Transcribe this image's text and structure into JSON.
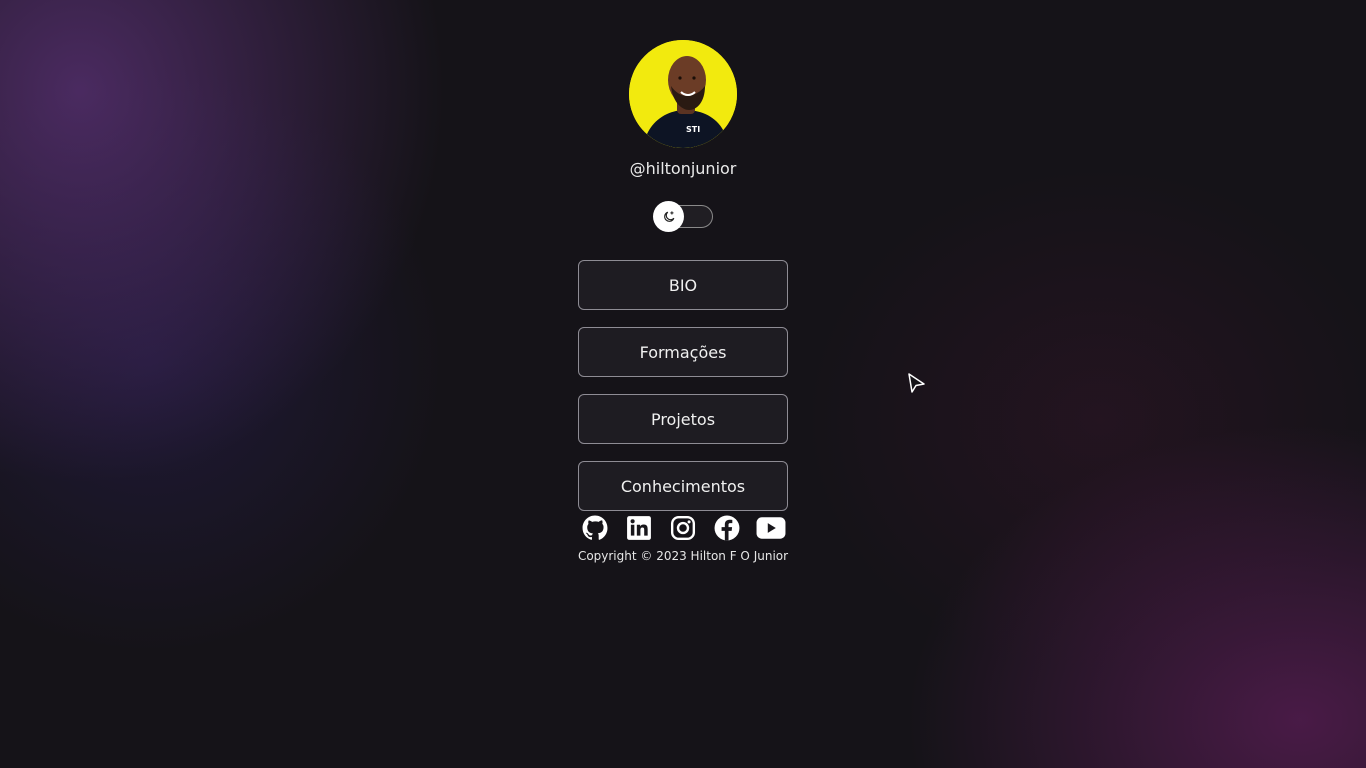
{
  "profile": {
    "handle": "@hiltonjunior",
    "avatar_icon": "profile-photo",
    "avatar_bg": "#f2ea0e"
  },
  "theme_toggle": {
    "icon": "moon-icon",
    "state": "dark"
  },
  "links": [
    {
      "label": "BIO"
    },
    {
      "label": "Formações"
    },
    {
      "label": "Projetos"
    },
    {
      "label": "Conhecimentos"
    }
  ],
  "socials": [
    {
      "icon": "github-icon"
    },
    {
      "icon": "linkedin-icon"
    },
    {
      "icon": "instagram-icon"
    },
    {
      "icon": "facebook-icon"
    },
    {
      "icon": "youtube-icon"
    }
  ],
  "footer": {
    "copyright": "Copyright © 2023 Hilton F O Junior"
  }
}
